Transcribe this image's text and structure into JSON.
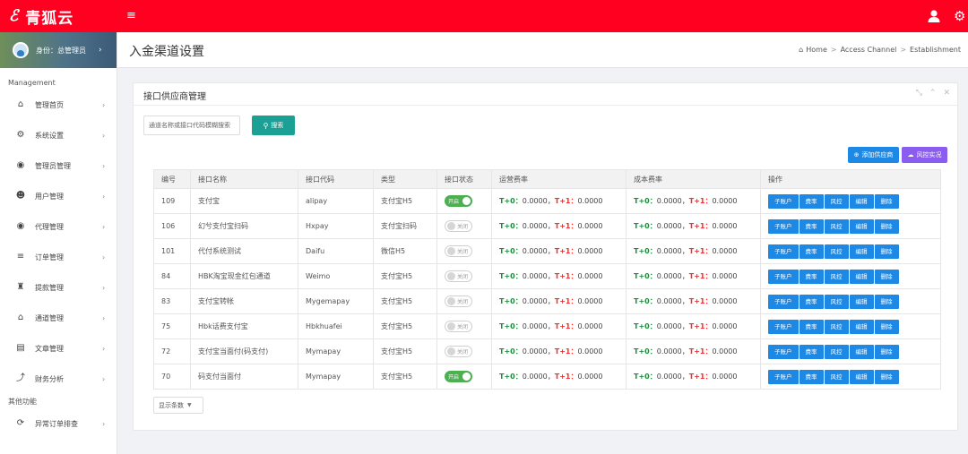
{
  "header": {
    "logo_mark": "ℰ",
    "brand": "青狐云",
    "menu_icon": "≡",
    "gear_icon": "⚙"
  },
  "sidebar": {
    "profile_label": "身份：总管理员",
    "section_management": "Management",
    "items": [
      {
        "icon": "⌂",
        "label": "管理首页"
      },
      {
        "icon": "⚙",
        "label": "系统设置"
      },
      {
        "icon": "◉",
        "label": "管理员管理"
      },
      {
        "icon": "☻",
        "label": "用户管理"
      },
      {
        "icon": "◉",
        "label": "代理管理"
      },
      {
        "icon": "≡",
        "label": "订单管理"
      },
      {
        "icon": "♜",
        "label": "提款管理"
      },
      {
        "icon": "⌂",
        "label": "通道管理"
      },
      {
        "icon": "▤",
        "label": "文章管理"
      },
      {
        "icon": "⤴",
        "label": "财务分析"
      }
    ],
    "section_other": "其他功能",
    "other_items": [
      {
        "icon": "⟳",
        "label": "异常订单排查"
      }
    ],
    "chevron": "›"
  },
  "page": {
    "title": "入金渠道设置",
    "breadcrumb": [
      "Home",
      "Access Channel",
      "Establishment"
    ]
  },
  "panel": {
    "title": "接口供应商管理",
    "tools": [
      "⤡",
      "⌃",
      "✕"
    ],
    "search": {
      "placeholder": "通道名称或接口代码模糊搜索",
      "button_label": "搜索",
      "button_icon": "🔍"
    },
    "add_button": "添加供应商",
    "risk_button": "风控实况",
    "page_size_label": "显示条数"
  },
  "table": {
    "headers": [
      "编号",
      "接口名称",
      "接口代码",
      "类型",
      "接口状态",
      "运营费率",
      "成本费率",
      "操作"
    ],
    "rows": [
      {
        "id": "109",
        "name": "支付宝",
        "code": "alipay",
        "type": "支付宝H5",
        "status": "开启",
        "on": true
      },
      {
        "id": "106",
        "name": "幻兮支付宝扫码",
        "code": "Hxpay",
        "type": "支付宝扫码",
        "status": "关闭",
        "on": false
      },
      {
        "id": "101",
        "name": "代付系统测试",
        "code": "Daifu",
        "type": "微信H5",
        "status": "关闭",
        "on": false
      },
      {
        "id": "84",
        "name": "HBK淘宝现金红包通道",
        "code": "Weimo",
        "type": "支付宝H5",
        "status": "关闭",
        "on": false
      },
      {
        "id": "83",
        "name": "支付宝转帐",
        "code": "Mygemapay",
        "type": "支付宝H5",
        "status": "关闭",
        "on": false
      },
      {
        "id": "75",
        "name": "Hbk话费支付宝",
        "code": "Hbkhuafei",
        "type": "支付宝H5",
        "status": "关闭",
        "on": false
      },
      {
        "id": "72",
        "name": "支付宝当面付(码支付)",
        "code": "Mymapay",
        "type": "支付宝H5",
        "status": "关闭",
        "on": false
      },
      {
        "id": "70",
        "name": "码支付当面付",
        "code": "Mymapay",
        "type": "支付宝H5",
        "status": "开启",
        "on": true
      }
    ],
    "rate": {
      "t0_label": "T+0：",
      "t0_value": "0.0000，",
      "t1_label": "T+1：",
      "t1_value": "0.0000"
    },
    "ops": [
      "子账户",
      "费率",
      "风控",
      "编辑",
      "删除"
    ]
  },
  "colors": {
    "brand_red": "#ff0021",
    "teal": "#1aa094",
    "blue": "#1e88e5",
    "purple": "#8a5cf0",
    "green": "#4caf50"
  }
}
